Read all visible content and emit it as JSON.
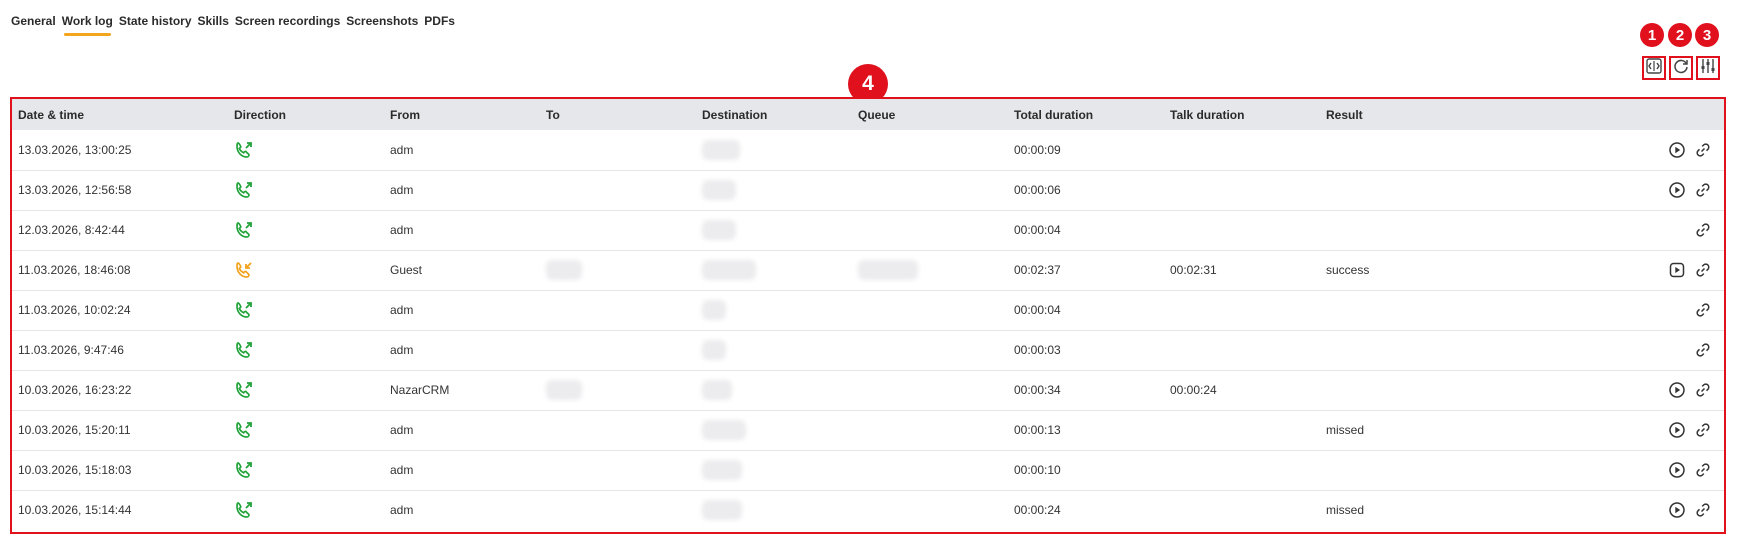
{
  "tabs": [
    {
      "label": "General",
      "active": false
    },
    {
      "label": "Work log",
      "active": true
    },
    {
      "label": "State history",
      "active": false
    },
    {
      "label": "Skills",
      "active": false
    },
    {
      "label": "Screen recordings",
      "active": false
    },
    {
      "label": "Screenshots",
      "active": false
    },
    {
      "label": "PDFs",
      "active": false
    }
  ],
  "badges": {
    "b1": "1",
    "b2": "2",
    "b3": "3",
    "b4": "4"
  },
  "toolbar": {
    "icons": [
      "expand-columns-icon",
      "refresh-icon",
      "filter-sliders-icon"
    ]
  },
  "colors": {
    "accent": "#f3a51c",
    "highlight": "#e0101d",
    "outgoing": "#22a33a",
    "incoming": "#f2a21b",
    "header_bg": "#e6e7ea"
  },
  "columns": [
    "Date & time",
    "Direction",
    "From",
    "To",
    "Destination",
    "Queue",
    "Total duration",
    "Talk duration",
    "Result"
  ],
  "rows": [
    {
      "datetime": "13.03.2026, 13:00:25",
      "direction": "outgoing",
      "from": "adm",
      "total": "00:00:09",
      "talk": "",
      "result": "",
      "actions": [
        "play",
        "link"
      ]
    },
    {
      "datetime": "13.03.2026, 12:56:58",
      "direction": "outgoing",
      "from": "adm",
      "total": "00:00:06",
      "talk": "",
      "result": "",
      "actions": [
        "play",
        "link"
      ]
    },
    {
      "datetime": "12.03.2026, 8:42:44",
      "direction": "outgoing",
      "from": "adm",
      "total": "00:00:04",
      "talk": "",
      "result": "",
      "actions": [
        "link"
      ]
    },
    {
      "datetime": "11.03.2026, 18:46:08",
      "direction": "incoming",
      "from": "Guest",
      "total": "00:02:37",
      "talk": "00:02:31",
      "result": "success",
      "actions": [
        "video",
        "link"
      ]
    },
    {
      "datetime": "11.03.2026, 10:02:24",
      "direction": "outgoing",
      "from": "adm",
      "total": "00:00:04",
      "talk": "",
      "result": "",
      "actions": [
        "link"
      ]
    },
    {
      "datetime": "11.03.2026, 9:47:46",
      "direction": "outgoing",
      "from": "adm",
      "total": "00:00:03",
      "talk": "",
      "result": "",
      "actions": [
        "link"
      ]
    },
    {
      "datetime": "10.03.2026, 16:23:22",
      "direction": "outgoing",
      "from": "NazarCRM",
      "total": "00:00:34",
      "talk": "00:00:24",
      "result": "",
      "actions": [
        "play",
        "link"
      ]
    },
    {
      "datetime": "10.03.2026, 15:20:11",
      "direction": "outgoing",
      "from": "adm",
      "total": "00:00:13",
      "talk": "",
      "result": "missed",
      "actions": [
        "play",
        "link"
      ]
    },
    {
      "datetime": "10.03.2026, 15:18:03",
      "direction": "outgoing",
      "from": "adm",
      "total": "00:00:10",
      "talk": "",
      "result": "",
      "actions": [
        "play",
        "link"
      ]
    },
    {
      "datetime": "10.03.2026, 15:14:44",
      "direction": "outgoing",
      "from": "adm",
      "total": "00:00:24",
      "talk": "",
      "result": "missed",
      "actions": [
        "play",
        "link"
      ]
    }
  ]
}
